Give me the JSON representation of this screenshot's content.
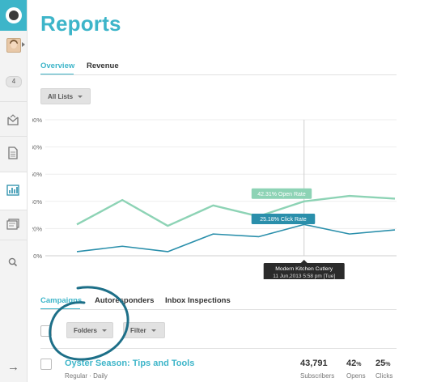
{
  "sidebar": {
    "notification_count": "4",
    "items": [
      {
        "icon": "campaigns-envelope-icon"
      },
      {
        "icon": "templates-document-icon"
      },
      {
        "icon": "reports-bar-chart-icon",
        "active": true
      },
      {
        "icon": "lists-icon"
      },
      {
        "icon": "search-icon"
      }
    ],
    "collapse_glyph": "→"
  },
  "page": {
    "title": "Reports"
  },
  "top_tabs": [
    {
      "label": "Overview",
      "active": true
    },
    {
      "label": "Revenue",
      "active": false
    }
  ],
  "list_filter": {
    "label": "All Lists"
  },
  "chart_data": {
    "type": "line",
    "y_ticks": [
      "100%",
      "80%",
      "60%",
      "40%",
      "20%",
      "0%"
    ],
    "ylim": [
      0,
      100
    ],
    "series": [
      {
        "name": "Open Rate",
        "color": "#8dd3b5",
        "values": [
          23,
          41,
          22,
          37,
          29,
          40,
          44,
          42
        ]
      },
      {
        "name": "Click Rate",
        "color": "#2a8fab",
        "values": [
          3,
          7,
          3,
          16,
          14,
          23,
          16,
          19
        ]
      }
    ],
    "labels": {
      "open_rate": "42.31% Open Rate",
      "click_rate": "25.18% Click Rate"
    },
    "tooltip": {
      "title": "Modern Kitchen Cutlery",
      "subtitle": "11 Jun,2013 5:58 pm [Tue]"
    },
    "grid": true
  },
  "bottom_tabs": [
    {
      "label": "Campaigns",
      "active": true
    },
    {
      "label": "Autoresponders",
      "active": false
    },
    {
      "label": "Inbox Inspections",
      "active": false
    }
  ],
  "buttons": {
    "folders": "Folders",
    "filter": "Filter"
  },
  "campaign_row": {
    "title": "Oyster Season: Tips and Tools",
    "subtitle": "Regular · Daily",
    "stats": [
      {
        "value": "43,791",
        "unit": "",
        "label": "Subscribers"
      },
      {
        "value": "42",
        "unit": "%",
        "label": "Opens"
      },
      {
        "value": "25",
        "unit": "%",
        "label": "Clicks"
      }
    ]
  },
  "colors": {
    "accent": "#3db5c9",
    "open_rate": "#8dd3b5",
    "click_rate": "#2a8fab",
    "annotation": "#1d6f88"
  }
}
